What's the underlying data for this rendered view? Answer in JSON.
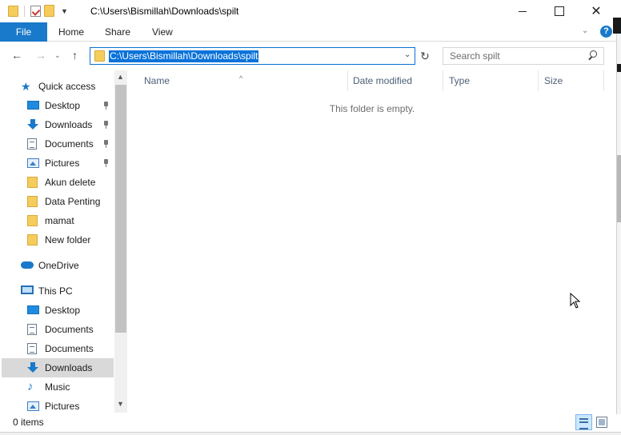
{
  "window": {
    "title": "C:\\Users\\Bismillah\\Downloads\\spilt"
  },
  "ribbon": {
    "tabs": [
      {
        "label": "File"
      },
      {
        "label": "Home"
      },
      {
        "label": "Share"
      },
      {
        "label": "View"
      }
    ],
    "help_label": "?"
  },
  "address": {
    "path": "C:\\Users\\Bismillah\\Downloads\\spilt"
  },
  "search": {
    "placeholder": "Search spilt"
  },
  "nav": {
    "items": [
      {
        "label": "Quick access",
        "icon": "star-icon"
      },
      {
        "label": "Desktop",
        "icon": "desktop-icon",
        "pinned": true
      },
      {
        "label": "Downloads",
        "icon": "download-arrow-icon",
        "pinned": true
      },
      {
        "label": "Documents",
        "icon": "document-icon",
        "pinned": true
      },
      {
        "label": "Pictures",
        "icon": "pictures-icon",
        "pinned": true
      },
      {
        "label": "Akun delete",
        "icon": "folder-icon"
      },
      {
        "label": "Data Penting",
        "icon": "folder-icon"
      },
      {
        "label": "mamat",
        "icon": "folder-icon"
      },
      {
        "label": "New folder",
        "icon": "folder-icon"
      },
      {
        "label": "OneDrive",
        "icon": "cloud-icon"
      },
      {
        "label": "This PC",
        "icon": "computer-icon"
      },
      {
        "label": "Desktop",
        "icon": "desktop-icon"
      },
      {
        "label": "Documents",
        "icon": "document-icon"
      },
      {
        "label": "Documents",
        "icon": "document-icon"
      },
      {
        "label": "Downloads",
        "icon": "download-arrow-icon",
        "selected": true
      },
      {
        "label": "Music",
        "icon": "music-note-icon"
      },
      {
        "label": "Pictures",
        "icon": "pictures-icon"
      }
    ]
  },
  "columns": {
    "name": "Name",
    "date_modified": "Date modified",
    "type": "Type",
    "size": "Size"
  },
  "content": {
    "empty_message": "This folder is empty."
  },
  "status": {
    "item_count": "0 items"
  },
  "colors": {
    "accent": "#1979ca",
    "selection": "#0a73d9",
    "selected_nav": "#d9d9d9"
  }
}
